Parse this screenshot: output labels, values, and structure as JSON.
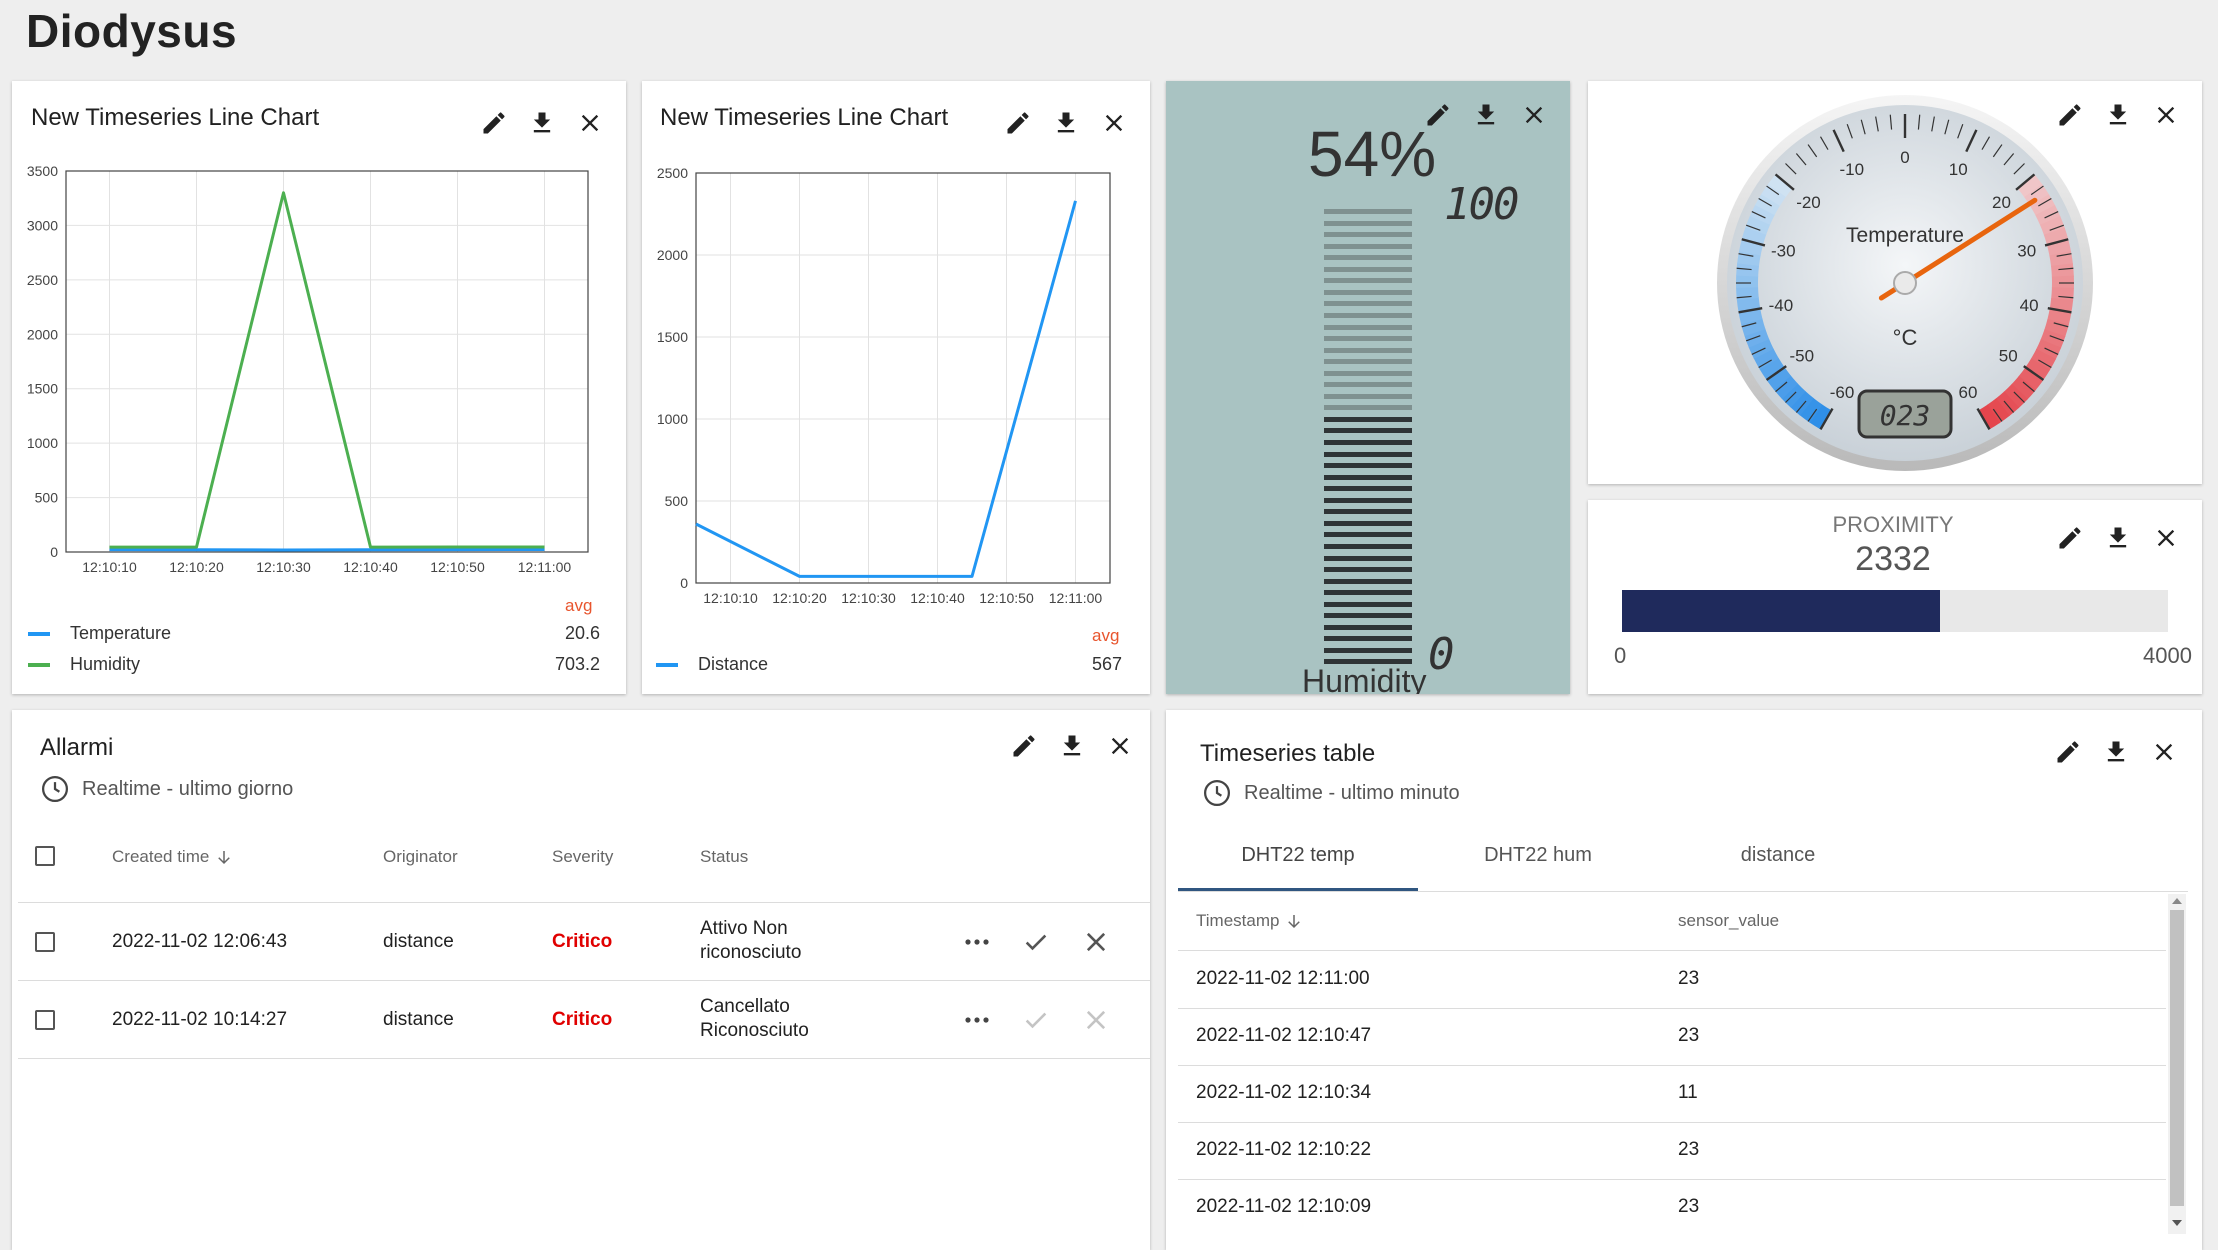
{
  "app": {
    "title": "Diodysus"
  },
  "widgets": {
    "chart1": {
      "title": "New Timeseries Line Chart",
      "avg_label": "avg",
      "legend": [
        {
          "name": "Temperature",
          "color": "#2196f3",
          "avg": "20.6"
        },
        {
          "name": "Humidity",
          "color": "#4caf50",
          "avg": "703.2"
        }
      ]
    },
    "chart2": {
      "title": "New Timeseries Line Chart",
      "avg_label": "avg",
      "legend": [
        {
          "name": "Distance",
          "color": "#2196f3",
          "avg": "567"
        }
      ]
    },
    "humidity": {
      "value": "54%",
      "max": "100",
      "min": "0",
      "label": "Humidity",
      "level": 0.54,
      "bg_color": "#a9c3c2"
    },
    "gauge": {
      "label": "Temperature",
      "unit": "°C",
      "lcd": "023",
      "ticks": [
        "-60",
        "-50",
        "-40",
        "-30",
        "-20",
        "-10",
        "0",
        "10",
        "20",
        "30",
        "40",
        "50",
        "60"
      ],
      "value": 23,
      "min": -60,
      "max": 60
    },
    "proximity": {
      "title": "PROXIMITY",
      "value": "2332",
      "min": "0",
      "max": "4000",
      "fraction": 0.583,
      "bar_color": "#1f2a5c"
    },
    "alarms": {
      "title": "Allarmi",
      "timewindow": "Realtime - ultimo giorno",
      "columns": [
        "Created time",
        "Originator",
        "Severity",
        "Status"
      ],
      "rows": [
        {
          "created": "2022-11-02 12:06:43",
          "originator": "distance",
          "severity": "Critico",
          "status_1": "Attivo Non",
          "status_2": "riconosciuto"
        },
        {
          "created": "2022-11-02 10:14:27",
          "originator": "distance",
          "severity": "Critico",
          "status_1": "Cancellato",
          "status_2": "Riconosciuto"
        }
      ]
    },
    "tstable": {
      "title": "Timeseries table",
      "timewindow": "Realtime - ultimo minuto",
      "tabs": [
        "DHT22 temp",
        "DHT22 hum",
        "distance"
      ],
      "columns": [
        "Timestamp",
        "sensor_value"
      ],
      "rows": [
        {
          "ts": "2022-11-02 12:11:00",
          "value": "23"
        },
        {
          "ts": "2022-11-02 12:10:47",
          "value": "23"
        },
        {
          "ts": "2022-11-02 12:10:34",
          "value": "11"
        },
        {
          "ts": "2022-11-02 12:10:22",
          "value": "23"
        },
        {
          "ts": "2022-11-02 12:10:09",
          "value": "23"
        }
      ]
    }
  },
  "chart_data": [
    {
      "type": "line",
      "x": [
        "12:10:10",
        "12:10:20",
        "12:10:30",
        "12:10:40",
        "12:10:50",
        "12:11:00"
      ],
      "ylim": [
        0,
        3500
      ],
      "yticks": [
        "0",
        "500",
        "1000",
        "1500",
        "2000",
        "2500",
        "3000",
        "3500"
      ],
      "series": [
        {
          "name": "Temperature",
          "color": "#2196f3",
          "points": [
            [
              1,
              22
            ],
            [
              3,
              21
            ],
            [
              5,
              18
            ],
            [
              7,
              20
            ],
            [
              9,
              22
            ],
            [
              11,
              23
            ]
          ]
        },
        {
          "name": "Humidity",
          "color": "#4caf50",
          "points": [
            [
              1,
              45
            ],
            [
              3,
              45
            ],
            [
              5,
              3300
            ],
            [
              7,
              45
            ],
            [
              9,
              46
            ],
            [
              11,
              46
            ]
          ]
        }
      ]
    },
    {
      "type": "line",
      "x": [
        "12:10:10",
        "12:10:20",
        "12:10:30",
        "12:10:40",
        "12:10:50",
        "12:11:00"
      ],
      "ylim": [
        0,
        2500
      ],
      "yticks": [
        "0",
        "500",
        "1000",
        "1500",
        "2000",
        "2500"
      ],
      "series": [
        {
          "name": "Distance",
          "color": "#2196f3",
          "points": [
            [
              0,
              360
            ],
            [
              3,
              40
            ],
            [
              8,
              40
            ],
            [
              11,
              2330
            ]
          ]
        }
      ]
    }
  ]
}
